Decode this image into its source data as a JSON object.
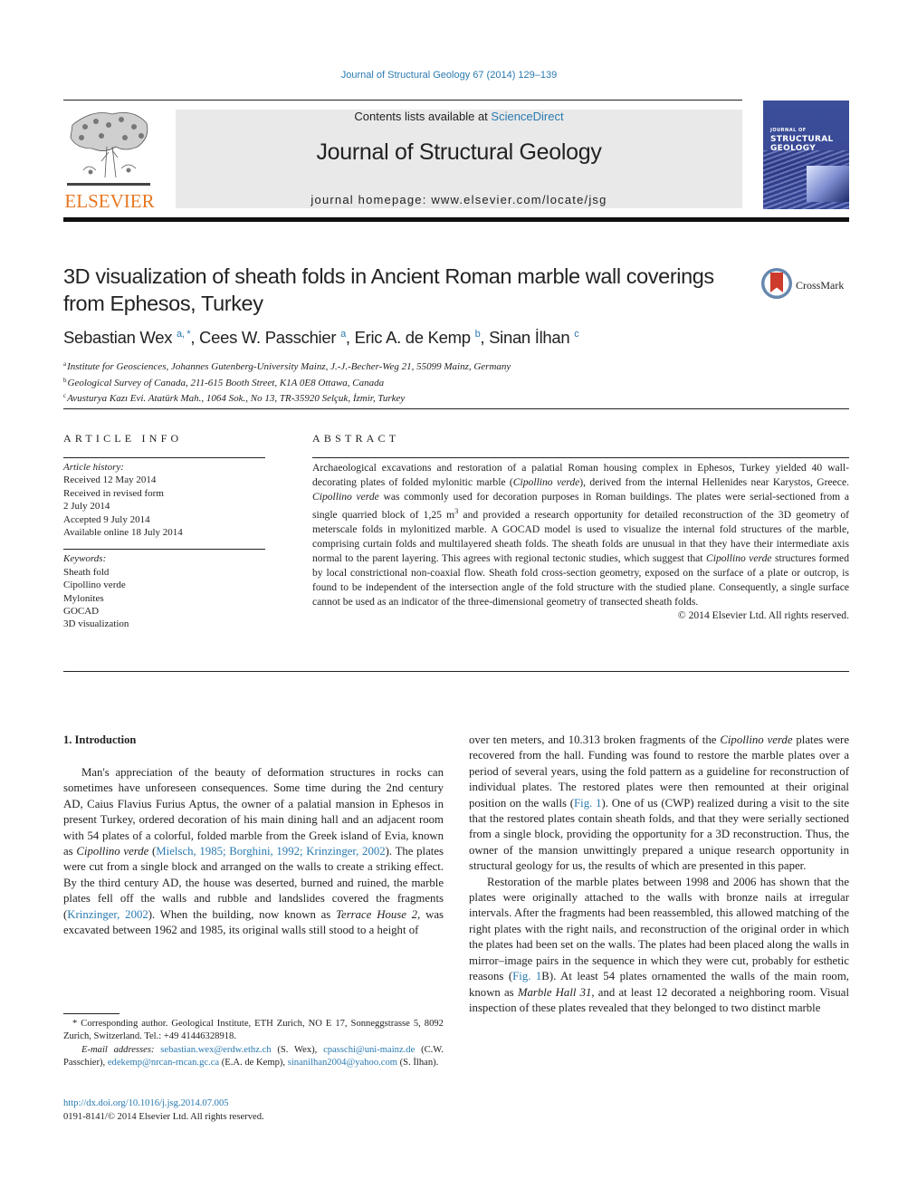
{
  "header": {
    "citation": "Journal of Structural Geology 67 (2014) 129–139",
    "contents_prefix": "Contents lists available at ",
    "contents_link": "ScienceDirect",
    "journal_name": "Journal of Structural Geology",
    "homepage": "journal homepage: www.elsevier.com/locate/jsg",
    "publisher_logo": "ELSEVIER",
    "cover": {
      "line1": "JOURNAL OF",
      "line2": "STRUCTURAL",
      "line3": "GEOLOGY"
    },
    "crossmark": "CrossMark",
    "colors": {
      "link": "#2a7ab0",
      "elsevier_orange": "#e87722",
      "banner_bg": "#e9e9e9"
    }
  },
  "article": {
    "title": "3D visualization of sheath folds in Ancient Roman marble wall coverings from Ephesos, Turkey",
    "authors": [
      {
        "name": "Sebastian Wex",
        "sup": "a, *",
        "sep": ", "
      },
      {
        "name": "Cees W. Passchier",
        "sup": "a",
        "sep": ", "
      },
      {
        "name": "Eric A. de Kemp",
        "sup": "b",
        "sep": ", "
      },
      {
        "name": "Sinan İlhan",
        "sup": "c",
        "sep": ""
      }
    ],
    "affiliations": [
      {
        "sup": "a",
        "text": "Institute for Geosciences, Johannes Gutenberg-University Mainz, J.-J.-Becher-Weg 21, 55099 Mainz, Germany"
      },
      {
        "sup": "b",
        "text": "Geological Survey of Canada, 211-615 Booth Street, K1A 0E8 Ottawa, Canada"
      },
      {
        "sup": "c",
        "text": "Avusturya Kazı Evi. Atatürk Mah., 1064 Sok., No 13, TR-35920 Selçuk, İzmir, Turkey"
      }
    ]
  },
  "article_info": {
    "label": "ARTICLE INFO",
    "history_header": "Article history:",
    "history": [
      "Received 12 May 2014",
      "Received in revised form",
      "2 July 2014",
      "Accepted 9 July 2014",
      "Available online 18 July 2014"
    ],
    "keywords_header": "Keywords:",
    "keywords": [
      "Sheath fold",
      "Cipollino verde",
      "Mylonites",
      "GOCAD",
      "3D visualization"
    ]
  },
  "abstract": {
    "label": "ABSTRACT",
    "p1": "Archaeological excavations and restoration of a palatial Roman housing complex in Ephesos, Turkey yielded 40 wall-decorating plates of folded mylonitic marble (",
    "i1": "Cipollino verde",
    "p2": "), derived from the internal Hellenides near Karystos, Greece. ",
    "i2": "Cipollino verde",
    "p3": " was commonly used for decoration purposes in Roman buildings. The plates were serial-sectioned from a single quarried block of 1,25 m",
    "sup": "3",
    "p4": " and provided a research opportunity for detailed reconstruction of the 3D geometry of meterscale folds in mylonitized marble. A GOCAD model is used to visualize the internal fold structures of the marble, comprising curtain folds and multilayered sheath folds. The sheath folds are unusual in that they have their intermediate axis normal to the parent layering. This agrees with regional tectonic studies, which suggest that ",
    "i3": "Cipollino verde",
    "p5": " structures formed by local constrictional non-coaxial flow. Sheath fold cross-section geometry, exposed on the surface of a plate or outcrop, is found to be independent of the intersection angle of the fold structure with the studied plane. Consequently, a single surface cannot be used as an indicator of the three-dimensional geometry of transected sheath folds.",
    "copyright": "© 2014 Elsevier Ltd. All rights reserved."
  },
  "body": {
    "section_heading": "1.  Introduction",
    "left": {
      "t1": "Man's appreciation of the beauty of deformation structures in rocks can sometimes have unforeseen consequences. Some time during the 2nd century AD, Caius Flavius Furius Aptus, the owner of a palatial mansion in Ephesos in present Turkey, ordered decoration of his main dining hall and an adjacent room with 54 plates of a colorful, folded marble from the Greek island of Evia, known as ",
      "i1": "Cipollino verde",
      "t2": " (",
      "ref1": "Mielsch, 1985; Borghini, 1992; Krinzinger, 2002",
      "t3": "). The plates were cut from a single block and arranged on the walls to create a striking effect. By the third century AD, the house was deserted, burned and ruined, the marble plates fell off the walls and rubble and landslides covered the fragments (",
      "ref2": "Krinzinger, 2002",
      "t4": "). When the building, now known as ",
      "i2": "Terrace House 2",
      "t5": ", was excavated between 1962 and 1985, its original walls still stood to a height of"
    },
    "right": {
      "t1": "over ten meters, and 10.313 broken fragments of the ",
      "i1": "Cipollino verde",
      "t2": " plates were recovered from the hall. Funding was found to restore the marble plates over a period of several years, using the fold pattern as a guideline for reconstruction of individual plates. The restored plates were then remounted at their original position on the walls (",
      "ref1": "Fig. 1",
      "t3": "). One of us (CWP) realized during a visit to the site that the restored plates contain sheath folds, and that they were serially sectioned from a single block, providing the opportunity for a 3D reconstruction. Thus, the owner of the mansion unwittingly prepared a unique research opportunity in structural geology for us, the results of which are presented in this paper.",
      "p2_t1": "Restoration of the marble plates between 1998 and 2006 has shown that the plates were originally attached to the walls with bronze nails at irregular intervals. After the fragments had been reassembled, this allowed matching of the right plates with the right nails, and reconstruction of the original order in which the plates had been set on the walls. The plates had been placed along the walls in mirror–image pairs in the sequence in which they were cut, probably for esthetic reasons (",
      "p2_ref": "Fig. 1",
      "p2_t2": "B). At least 54 plates ornamented the walls of the main room, known as ",
      "p2_i1": "Marble Hall 31",
      "p2_t3": ", and at least 12 decorated a neighboring room. Visual inspection of these plates revealed that they belonged to two distinct marble"
    }
  },
  "footnotes": {
    "star": "* ",
    "corresponding": "Corresponding author. Geological Institute, ETH Zurich, NO E 17, Sonneggstrasse 5, 8092 Zurich, Switzerland. Tel.: +49 41446328918.",
    "email_label": "E-mail addresses: ",
    "emails": [
      {
        "addr": "sebastian.wex@erdw.ethz.ch",
        "who": " (S. Wex), "
      },
      {
        "addr": "cpasschi@uni-mainz.de",
        "who": " (C.W. Passchier), "
      },
      {
        "addr": "edekemp@nrcan-rncan.gc.ca",
        "who": " (E.A. de Kemp), "
      },
      {
        "addr": "sinanilhan2004@yahoo.com",
        "who": " (S. İlhan)."
      }
    ],
    "doi": "http://dx.doi.org/10.1016/j.jsg.2014.07.005",
    "issn": "0191-8141/© 2014 Elsevier Ltd. All rights reserved."
  }
}
